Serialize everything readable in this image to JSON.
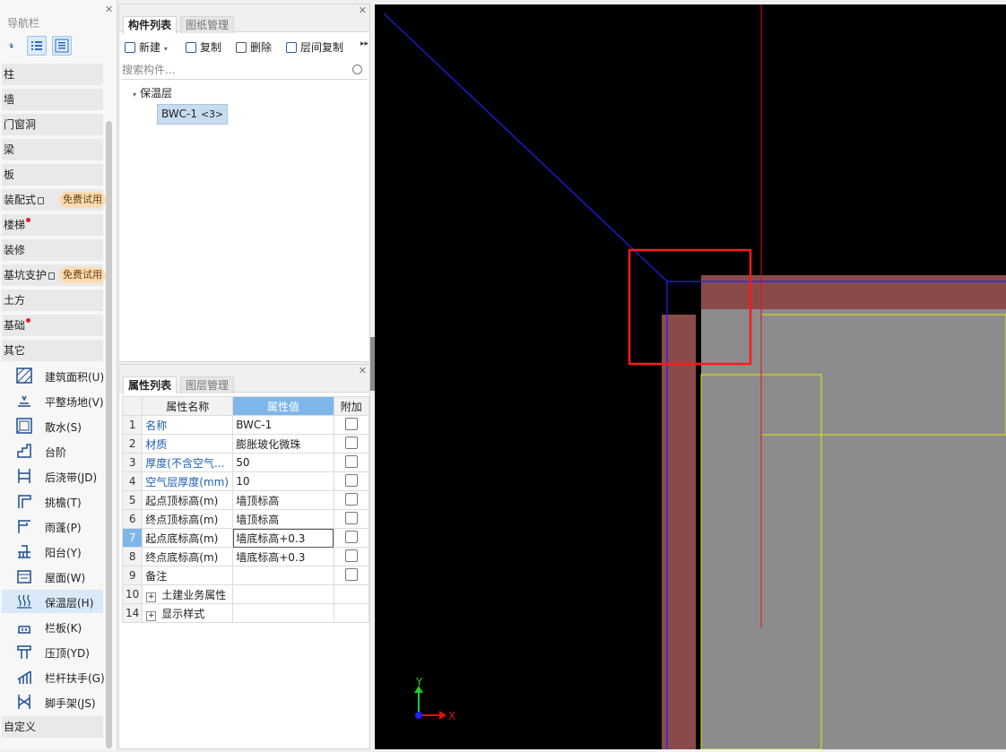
{
  "nav": {
    "title": "导航栏",
    "categories": [
      {
        "label": "柱"
      },
      {
        "label": "墙"
      },
      {
        "label": "门窗洞"
      },
      {
        "label": "梁"
      },
      {
        "label": "板"
      },
      {
        "label": "装配式",
        "badge": "免费试用"
      },
      {
        "label": "楼梯"
      },
      {
        "label": "装修"
      },
      {
        "label": "基坑支护",
        "badge": "免费试用"
      },
      {
        "label": "土方"
      },
      {
        "label": "基础"
      },
      {
        "label": "其它"
      }
    ],
    "others": [
      {
        "label": "建筑面积(U)",
        "icon": "building-area-icon"
      },
      {
        "label": "平整场地(V)",
        "icon": "site-leveling-icon"
      },
      {
        "label": "散水(S)",
        "icon": "apron-icon"
      },
      {
        "label": "台阶",
        "icon": "steps-icon"
      },
      {
        "label": "后浇带(JD)",
        "icon": "post-pour-strip-icon"
      },
      {
        "label": "挑檐(T)",
        "icon": "cornice-icon"
      },
      {
        "label": "雨蓬(P)",
        "icon": "canopy-icon"
      },
      {
        "label": "阳台(Y)",
        "icon": "balcony-icon"
      },
      {
        "label": "屋面(W)",
        "icon": "roof-icon"
      },
      {
        "label": "保温层(H)",
        "icon": "insulation-icon"
      },
      {
        "label": "栏板(K)",
        "icon": "parapet-icon"
      },
      {
        "label": "压顶(YD)",
        "icon": "coping-icon"
      },
      {
        "label": "栏杆扶手(G)",
        "icon": "railing-icon"
      },
      {
        "label": "脚手架(JS)",
        "icon": "scaffold-icon"
      }
    ],
    "custom": "自定义"
  },
  "component_panel": {
    "tabs": [
      "构件列表",
      "图纸管理"
    ],
    "toolbar": {
      "new": "新建",
      "copy": "复制",
      "delete": "删除",
      "floor_copy": "层间复制"
    },
    "search_placeholder": "搜索构件...",
    "tree": {
      "group": "保温层",
      "item": "BWC-1",
      "count": "<3>"
    }
  },
  "properties_panel": {
    "tabs": [
      "属性列表",
      "图层管理"
    ],
    "headers": [
      "属性名称",
      "属性值",
      "附加"
    ],
    "rows": [
      {
        "n": "1",
        "name": "名称",
        "value": "BWC-1",
        "check": true
      },
      {
        "n": "2",
        "name": "材质",
        "value": "膨胀玻化微珠",
        "check": true
      },
      {
        "n": "3",
        "name": "厚度(不含空气...",
        "value": "50",
        "check": true
      },
      {
        "n": "4",
        "name": "空气层厚度(mm)",
        "value": "10",
        "check": true
      },
      {
        "n": "5",
        "name": "起点顶标高(m)",
        "value": "墙顶标高",
        "check": true
      },
      {
        "n": "6",
        "name": "终点顶标高(m)",
        "value": "墙顶标高",
        "check": true
      },
      {
        "n": "7",
        "name": "起点底标高(m)",
        "value": "墙底标高+0.3",
        "check": true
      },
      {
        "n": "8",
        "name": "终点底标高(m)",
        "value": "墙底标高+0.3",
        "check": true
      },
      {
        "n": "9",
        "name": "备注",
        "value": "",
        "check": true
      },
      {
        "n": "10",
        "name": "土建业务属性",
        "value": "",
        "check": false
      },
      {
        "n": "14",
        "name": "显示样式",
        "value": "",
        "check": false
      }
    ]
  },
  "canvas": {
    "axis_x": "X",
    "axis_y": "Y"
  },
  "colors": {
    "accent": "#7fb6ea",
    "badge_bg": "#fbdcb4",
    "wall": "#8b4a4a",
    "slab": "#8c8c8c"
  }
}
